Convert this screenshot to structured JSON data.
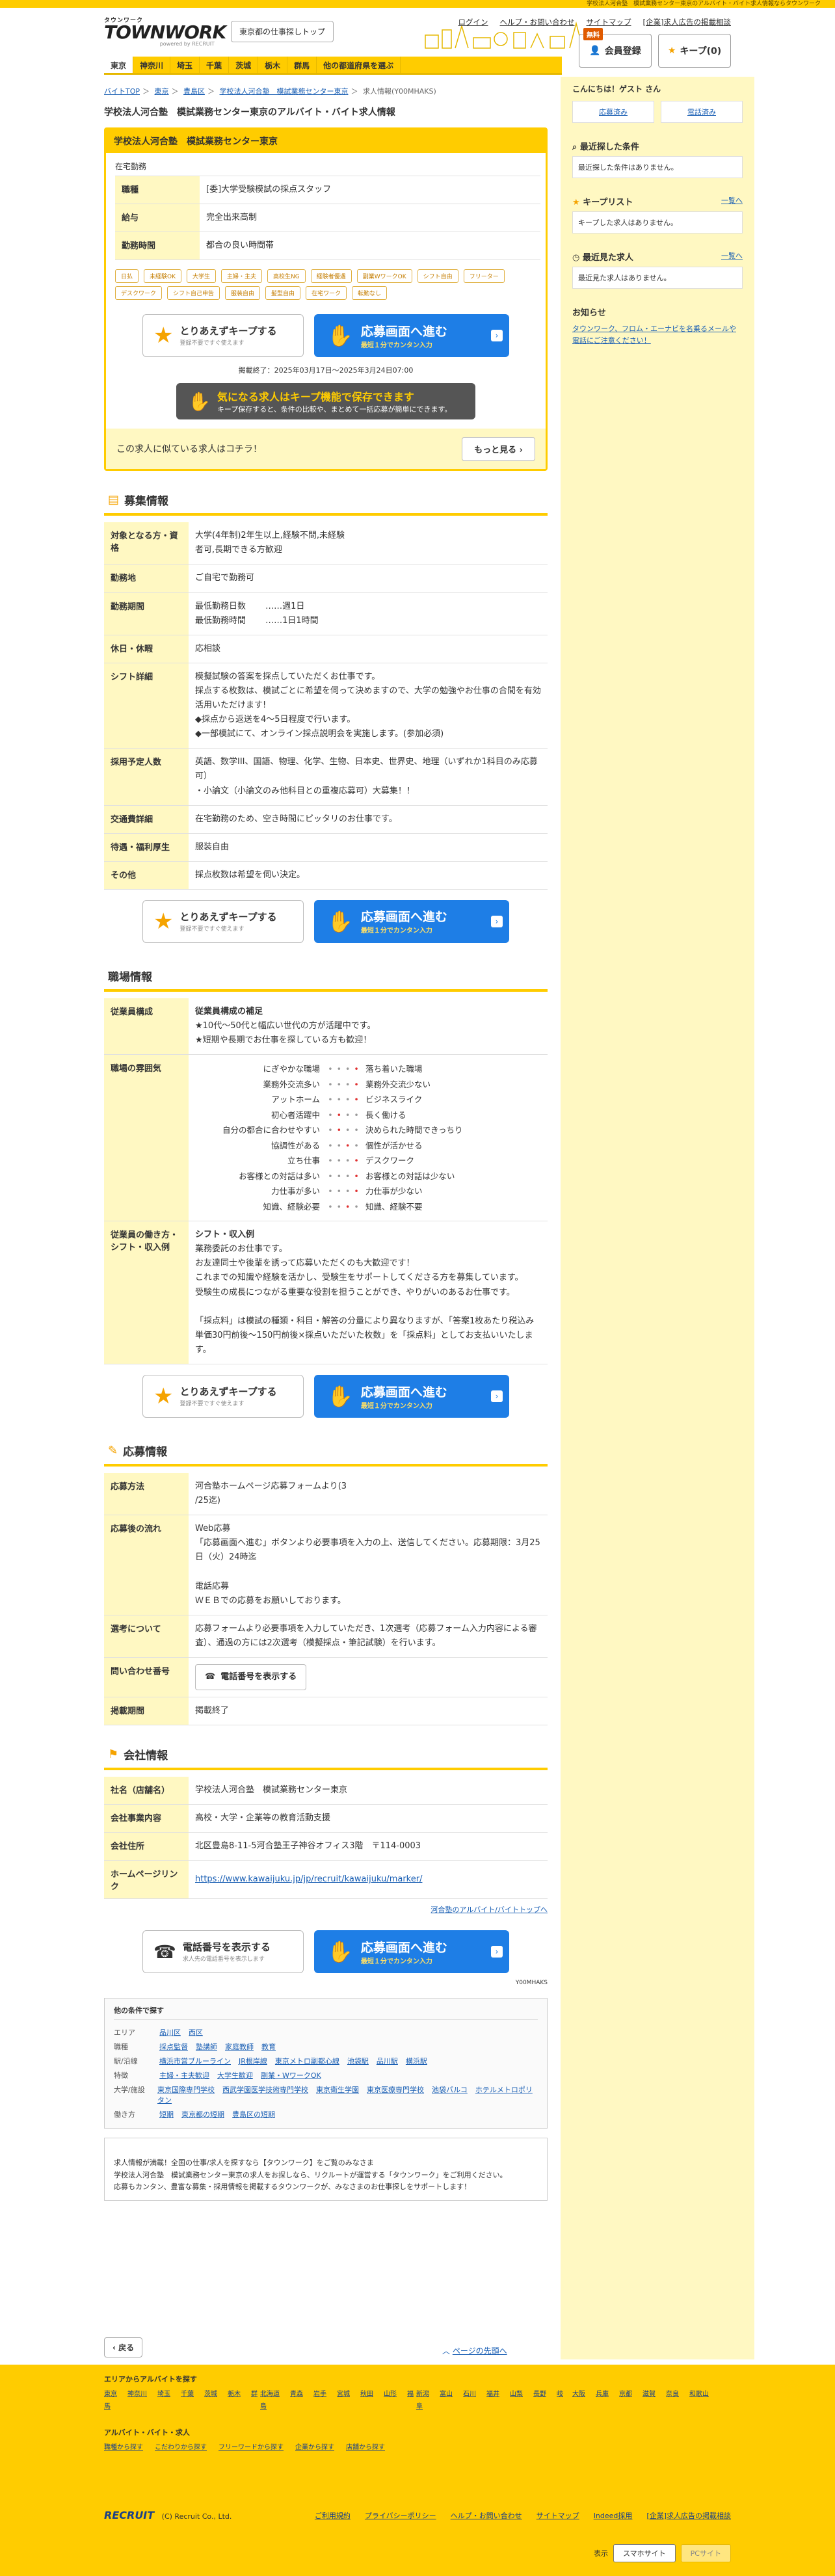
{
  "top_strip": "学校法人河合塾　模試業務センター東京のアルバイト・バイト求人情報ならタウンワーク",
  "brand": {
    "small": "タウンワーク",
    "logo": "TOWNWORK",
    "by": "powered by RECRUIT"
  },
  "header": {
    "area_button": "東京都の仕事探しトップ",
    "links": [
      "ログイン",
      "ヘルプ・お問い合わせ",
      "サイトマップ",
      "[企業]求人広告の掲載相談"
    ],
    "member_label": "会員登録",
    "member_tag": "無料",
    "keep_label": "キープ(0)"
  },
  "nav": [
    "東京",
    "神奈川",
    "埼玉",
    "千葉",
    "茨城",
    "栃木",
    "群馬",
    "他の都道府県を選ぶ"
  ],
  "breadcrumb": [
    "バイトTOP",
    "東京",
    "豊島区",
    "学校法人河合塾　模試業務センター東京"
  ],
  "breadcrumb_current": "求人情報(Y00MHAKS)",
  "page_title": "学校法人河合塾　模試業務センター東京のアルバイト・バイト求人情報",
  "job": {
    "company": "学校法人河合塾　模試業務センター東京",
    "workstyle": "在宅勤務",
    "rows": [
      {
        "k": "職種",
        "v": "[委]大学受験模試の採点スタッフ"
      },
      {
        "k": "給与",
        "v": "完全出来高制"
      },
      {
        "k": "勤務時間",
        "v": "都合の良い時間帯"
      }
    ],
    "tags": [
      "日払",
      "未経験OK",
      "大学生",
      "主婦・主夫",
      "高校生NG",
      "経験者優遇",
      "副業WワークOK",
      "シフト自由",
      "フリーター",
      "デスクワーク",
      "シフト自己申告",
      "服装自由",
      "髪型自由",
      "在宅ワーク",
      "転勤なし"
    ],
    "keep_btn": "とりあえずキープする",
    "keep_sub": "登録不要ですぐ使えます",
    "apply_btn": "応募画面へ進む",
    "apply_sub": "最短１分でカンタン入力",
    "period": "掲載終了：2025年03月17日〜2025年3月24日07:00",
    "banner_title": "気になる求人はキープ機能で保存できます",
    "banner_sub": "キープ保存すると、条件の比較や、まとめて一括応募が簡単にできます。",
    "similar_text": "この求人に似ている求人はコチラ！",
    "similar_more": "もっと見る"
  },
  "recruit": {
    "title": "募集情報",
    "rows": [
      {
        "k": "対象となる方・資格",
        "v": "大学(4年制)2年生以上,経験不問,未経験\n者可,長期できる方歓迎"
      },
      {
        "k": "勤務地",
        "v": "ご自宅で勤務可"
      },
      {
        "k": "勤務期間",
        "v": "最低勤務日数　　 ……週1日\n最低勤務時間　　 ……1日1時間"
      },
      {
        "k": "休日・休暇",
        "v": "応相談"
      },
      {
        "k": "シフト詳細",
        "v": "模擬試験の答案を採点していただくお仕事です。\n採点する枚数は、模試ごとに希望を伺って決めますので、大学の勉強やお仕事の合間を有効活用いただけます!\n◆採点から返送を4〜5日程度で行います。\n◆一部模試にて、オンライン採点説明会を実施します。(参加必須)"
      },
      {
        "k": "採用予定人数",
        "v": "英語、数学III、国語、物理、化学、生物、日本史、世界史、地理（いずれか1科目のみ応募可）\n・小論文（小論文のみ他科目との重複応募可）大募集！！"
      },
      {
        "k": "交通費詳細",
        "v": "在宅勤務のため、空き時間にピッタリのお仕事です。"
      },
      {
        "k": "待遇・福利厚生",
        "v": "服装自由"
      },
      {
        "k": "その他",
        "v": "採点枚数は希望を伺い決定。"
      }
    ]
  },
  "workplace": {
    "title": "職場情報",
    "staff_label": "従業員構成",
    "staff_head": "従業員構成の補足",
    "staff_text": "★10代〜50代と幅広い世代の方が活躍中です。\n★短期や長期でお仕事を探している方も歓迎！",
    "atm_label": "職場の雰囲気",
    "atm": [
      {
        "l": "にぎやかな職場",
        "r": "落ち着いた職場",
        "pos": 3
      },
      {
        "l": "業務外交流多い",
        "r": "業務外交流少ない",
        "pos": 3
      },
      {
        "l": "アットホーム",
        "r": "ビジネスライク",
        "pos": 3
      },
      {
        "l": "初心者活躍中",
        "r": "長く働ける",
        "pos": 1
      },
      {
        "l": "自分の都合に合わせやすい",
        "r": "決められた時間できっちり",
        "pos": 1
      },
      {
        "l": "協調性がある",
        "r": "個性が活かせる",
        "pos": 2
      },
      {
        "l": "立ち仕事",
        "r": "デスクワーク",
        "pos": 3
      },
      {
        "l": "お客様との対話は多い",
        "r": "お客様との対話は少ない",
        "pos": 3
      },
      {
        "l": "力仕事が多い",
        "r": "力仕事が少ない",
        "pos": 3
      },
      {
        "l": "知識、経験必要",
        "r": "知識、経験不要",
        "pos": 2
      }
    ],
    "voice_label": "従業員の働き方・シフト・収入例",
    "voice_head": "シフト・収入例",
    "voice_text": "業務委託のお仕事です。\nお友達同士や後輩を誘って応募いただくのも大歓迎です！\nこれまでの知識や経験を活かし、受験生をサポートしてくださる方を募集しています。\n受験生の成長につながる重要な役割を担うことができ、やりがいのあるお仕事です。\n\n「採点料」は模試の種類・科目・解答の分量により異なりますが、「答案1枚あたり税込み単価30円前後〜150円前後×採点いただいた枚数」を「採点料」としてお支払いいたします。"
  },
  "apply": {
    "title": "応募情報",
    "rows": [
      {
        "k": "応募方法",
        "v": "河合塾ホームページ応募フォームより(3\n/25迄)"
      },
      {
        "k": "応募後の流れ",
        "v": "Web応募\n「応募画面へ進む」ボタンより必要事項を入力の上、送信してください。応募期限：3月25日（火）24時迄\n\n電話応募\nＷＥＢでの応募をお願いしております。"
      },
      {
        "k": "選考について",
        "v": "応募フォームより必要事項を入力していただき、1次選考（応募フォーム入力内容による審査）、通過の方には2次選考（模擬採点・筆記試験）を行います。"
      },
      {
        "k": "問い合わせ番号",
        "v": ""
      },
      {
        "k": "掲載期間",
        "v": "掲載終了"
      }
    ],
    "phone_btn": "電話番号を表示する"
  },
  "company": {
    "title": "会社情報",
    "rows": [
      {
        "k": "社名（店舗名）",
        "v": "学校法人河合塾　模試業務センター東京"
      },
      {
        "k": "会社事業内容",
        "v": "高校・大学・企業等の教育活動支援"
      },
      {
        "k": "会社住所",
        "v": "北区豊島8-11-5河合塾王子神谷オフィス3階　〒114-0003"
      },
      {
        "k": "ホームページリンク",
        "v": ""
      }
    ],
    "homepage": "https://www.kawaijuku.jp/jp/recruit/kawaijuku/marker/",
    "more_link": "河合塾のアルバイト/バイトトップへ"
  },
  "bottom_cta": {
    "phone": "電話番号を表示する",
    "phone_sub": "求人先の電話番号を表示します"
  },
  "pub_id": "Y00MHAKS",
  "conditions": {
    "title": "他の条件で探す",
    "rows": [
      {
        "k": "エリア",
        "v": [
          "品川区",
          "西区"
        ]
      },
      {
        "k": "職種",
        "v": [
          "採点監督",
          "塾講師",
          "家庭教師",
          "教育"
        ]
      },
      {
        "k": "駅/沿線",
        "v": [
          "横浜市営ブルーライン",
          "JR根岸線",
          "東京メトロ副都心線",
          "池袋駅",
          "品川駅",
          "横浜駅"
        ]
      },
      {
        "k": "特徴",
        "v": [
          "主婦・主夫歓迎",
          "大学生歓迎",
          "副業・WワークOK"
        ]
      },
      {
        "k": "大学/施設",
        "v": [
          "東京国際専門学校",
          "西武学園医学技術専門学校",
          "東京衛生学園",
          "東京医療専門学校",
          "池袋パルコ",
          "ホテルメトロポリタン"
        ]
      },
      {
        "k": "働き方",
        "v": [
          "短期",
          "東京都の短期",
          "豊島区の短期"
        ]
      }
    ]
  },
  "disclaimer": "求人情報が満載！全国の仕事/求人を探すなら【タウンワーク】をご覧のみなさま\n学校法人河合塾　模試業務センター東京の求人をお探しなら、リクルートが運営する「タウンワーク」をご利用ください。\n応募もカンタン、豊富な募集・採用情報を掲載するタウンワークが、みなさまのお仕事探しをサポートします！",
  "back_button": "戻る",
  "page_top": "ページの先頭へ",
  "sidebar": {
    "greeting": "こんにちは！ゲスト さん",
    "btn1": "応募済み",
    "btn2": "電話済み",
    "recent_conditions": "最近探した条件",
    "recent_conditions_empty": "最近探した条件はありません。",
    "keeplist": "キープリスト",
    "keeplist_more": "一覧へ",
    "keeplist_empty": "キープした求人はありません。",
    "recent_jobs": "最近見た求人",
    "recent_jobs_more": "一覧へ",
    "recent_jobs_empty": "最近見た求人はありません。",
    "notice_title": "お知らせ",
    "notice_text": "タウンワーク、フロム・エーナビを名乗るメールや電話にご注意ください！"
  },
  "footer": {
    "area_head": "エリアからアルバイトを探す",
    "areas": [
      [
        "東京",
        "神奈川",
        "埼玉",
        "千葉",
        "茨城",
        "栃木",
        "群馬"
      ],
      [
        "北海道",
        "青森",
        "岩手",
        "宮城",
        "秋田",
        "山形",
        "福島"
      ],
      [
        "新潟",
        "富山",
        "石川",
        "福井",
        "山梨",
        "長野",
        "岐阜"
      ],
      [
        "大阪",
        "兵庫",
        "京都",
        "滋賀",
        "奈良",
        "和歌山"
      ]
    ],
    "job_head": "アルバイト・バイト・求人",
    "job_links": [
      "職種から探す",
      "こだわりから探す",
      "フリーワードから探す",
      "企業から探す",
      "店舗から探す"
    ],
    "recruit": "RECRUIT",
    "copyright": "(C) Recruit Co., Ltd.",
    "links": [
      "ご利用規約",
      "プライバシーポリシー",
      "ヘルプ・お問い合わせ",
      "サイトマップ",
      "Indeed採用",
      "[企業]求人広告の掲載相談"
    ],
    "display": "表示",
    "smartphone": "スマホサイト",
    "pc": "PCサイト"
  }
}
